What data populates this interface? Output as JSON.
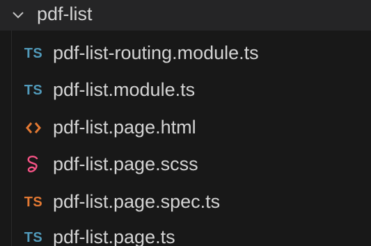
{
  "explorer": {
    "folder": {
      "name": "pdf-list",
      "expanded": true,
      "icon": "chevron-down-icon"
    },
    "files": [
      {
        "name": "pdf-list-routing.module.ts",
        "icon": "typescript-icon",
        "icon_text": "TS",
        "icon_color": "#519aba"
      },
      {
        "name": "pdf-list.module.ts",
        "icon": "typescript-icon",
        "icon_text": "TS",
        "icon_color": "#519aba"
      },
      {
        "name": "pdf-list.page.html",
        "icon": "html-icon",
        "icon_text": "<>",
        "icon_color": "#e37933"
      },
      {
        "name": "pdf-list.page.scss",
        "icon": "sass-icon",
        "icon_text": "",
        "icon_color": "#f55385"
      },
      {
        "name": "pdf-list.page.spec.ts",
        "icon": "typescript-spec-icon",
        "icon_text": "TS",
        "icon_color": "#e37933"
      },
      {
        "name": "pdf-list.page.ts",
        "icon": "typescript-icon",
        "icon_text": "TS",
        "icon_color": "#519aba"
      }
    ]
  }
}
